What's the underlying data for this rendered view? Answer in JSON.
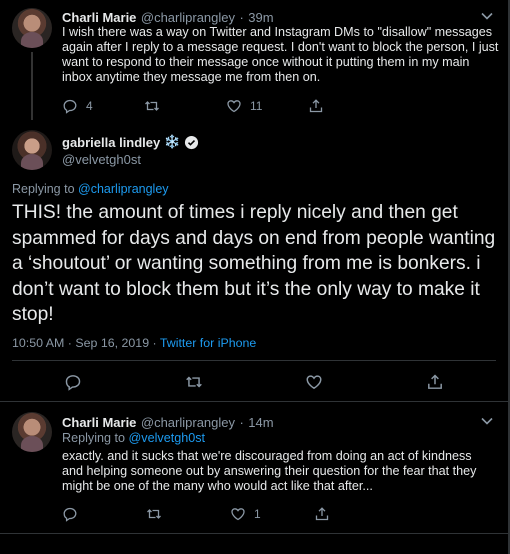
{
  "tweet1": {
    "name": "Charli Marie",
    "handle": "@charliprangley",
    "dot": "·",
    "time": "39m",
    "text": "I wish there was a way on Twitter and Instagram DMs to \"disallow\" messages again after I reply to a message request. I don't want to block the person, I just want to respond to their message once without it putting them in my main inbox anytime they message me from then on.",
    "reply_count": "4",
    "like_count": "11"
  },
  "tweet2": {
    "name": "gabriella lindley",
    "name_emoji": "❄️",
    "handle": "@velvetgh0st",
    "replying_prefix": "Replying to",
    "replying_to": "@charliprangley",
    "text": "THIS! the amount of times i reply nicely and then get spammed for days and days on end from people wanting a ‘shoutout’ or wanting something from me is bonkers. i don’t want to block them but it’s the only way to make it stop!",
    "timestamp": "10:50 AM · Sep 16, 2019 ·",
    "source": "Twitter for iPhone"
  },
  "tweet3": {
    "name": "Charli Marie",
    "handle": "@charliprangley",
    "dot": "·",
    "time": "14m",
    "replying_prefix": "Replying to",
    "replying_to": "@velvetgh0st",
    "text": "exactly. and it sucks that we're discouraged from doing an act of kindness and helping someone out by answering their question for the fear that they might be one of the many who would act like that after...",
    "like_count": "1"
  },
  "icons": {
    "reply": "reply-icon",
    "retweet": "retweet-icon",
    "like": "heart-icon",
    "share": "share-icon",
    "more": "chevron-down-icon",
    "verified": "verified-badge-icon"
  },
  "colors": {
    "background": "#000000",
    "link": "#1d9bf0",
    "muted": "#8b98a5",
    "text": "#e7e9ea"
  }
}
